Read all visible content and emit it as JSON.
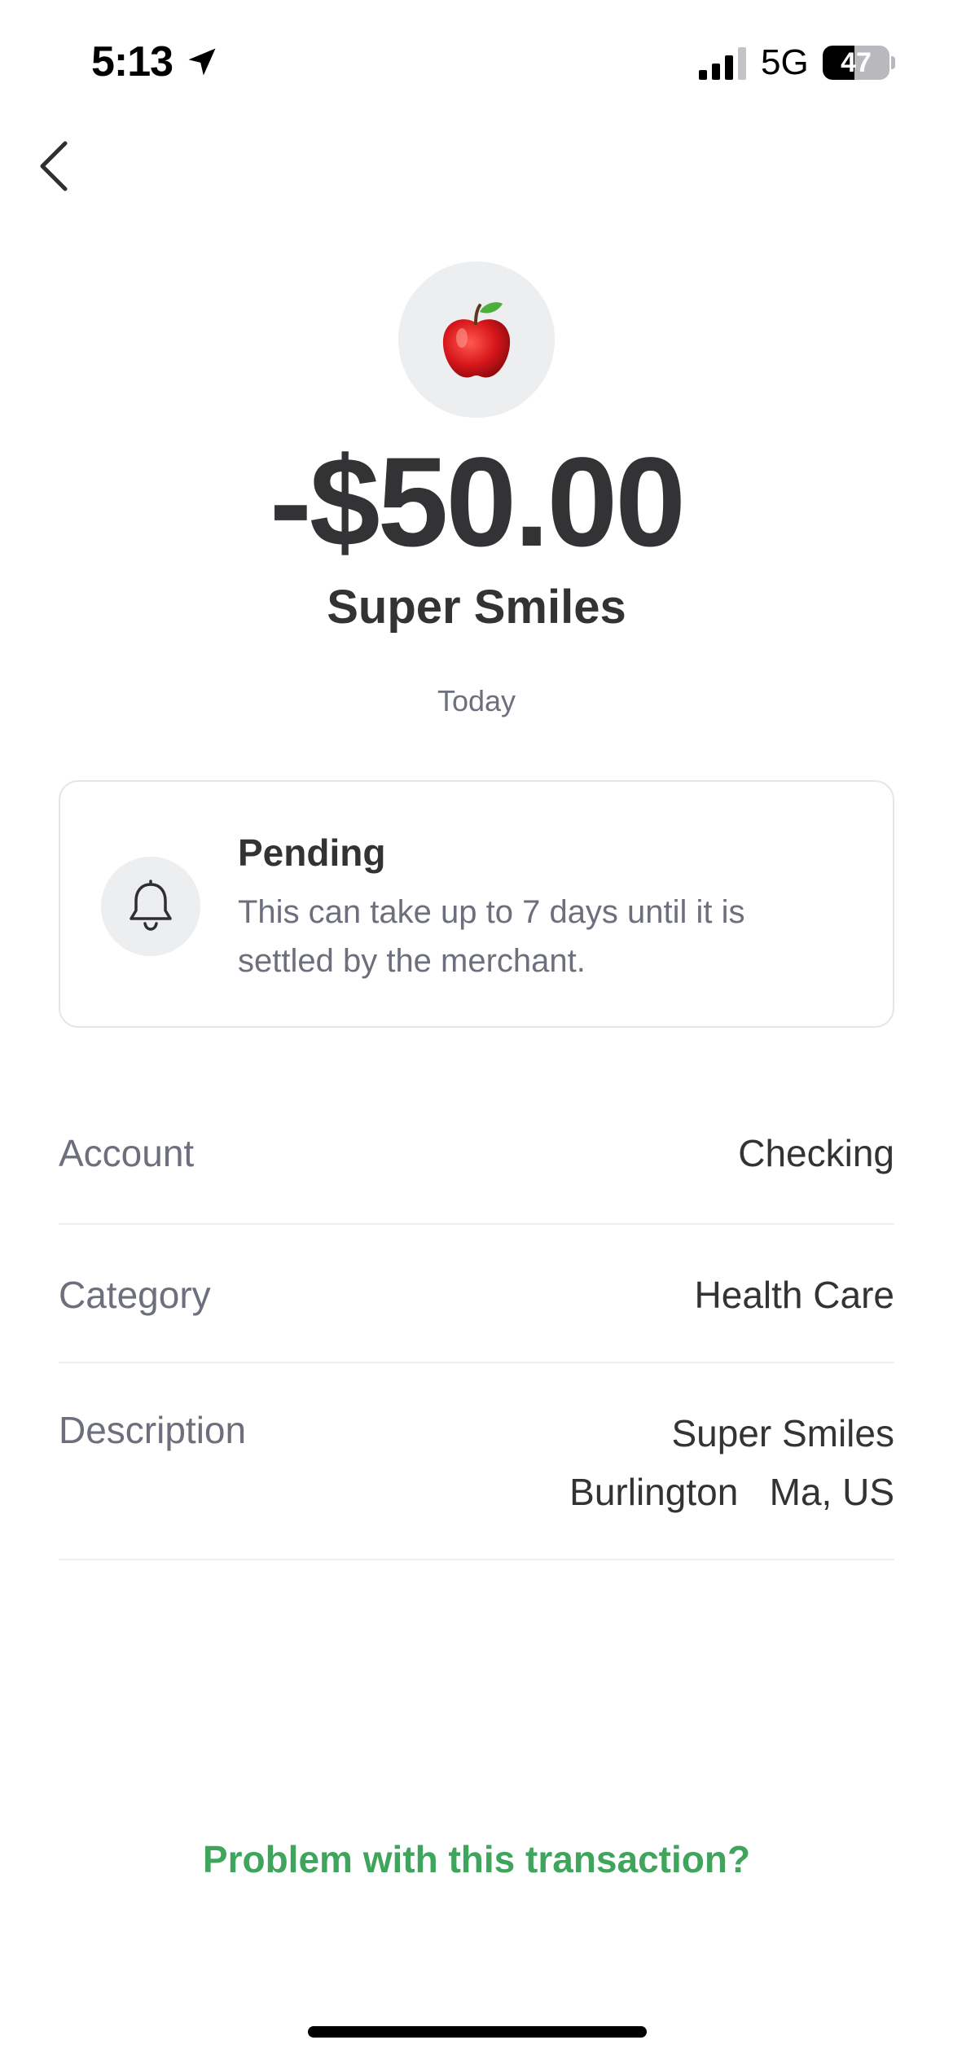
{
  "status_bar": {
    "time": "5:13",
    "network": "5G",
    "battery_level": "47",
    "battery_fraction": 0.47,
    "icons": [
      "location-arrow-icon",
      "cellular-signal-icon",
      "battery-icon"
    ]
  },
  "navigation": {
    "back_icon": "chevron-left-icon"
  },
  "transaction": {
    "merchant_icon": "red-apple-emoji",
    "amount": "-$50.00",
    "merchant": "Super Smiles",
    "date": "Today"
  },
  "pending": {
    "icon": "bell-icon",
    "title": "Pending",
    "message": "This can take up to 7 days until it is settled by the merchant."
  },
  "details": {
    "account": {
      "label": "Account",
      "value": "Checking"
    },
    "category": {
      "label": "Category",
      "value": "Health Care"
    },
    "description": {
      "label": "Description",
      "line1": "Super Smiles",
      "line2": "Burlington   Ma, US"
    }
  },
  "footer": {
    "problem_link": "Problem with this transaction?"
  },
  "colors": {
    "accent_green": "#3fa55c",
    "text_primary": "#333336",
    "text_secondary": "#6d6f7d",
    "icon_bg": "#eceef0"
  }
}
